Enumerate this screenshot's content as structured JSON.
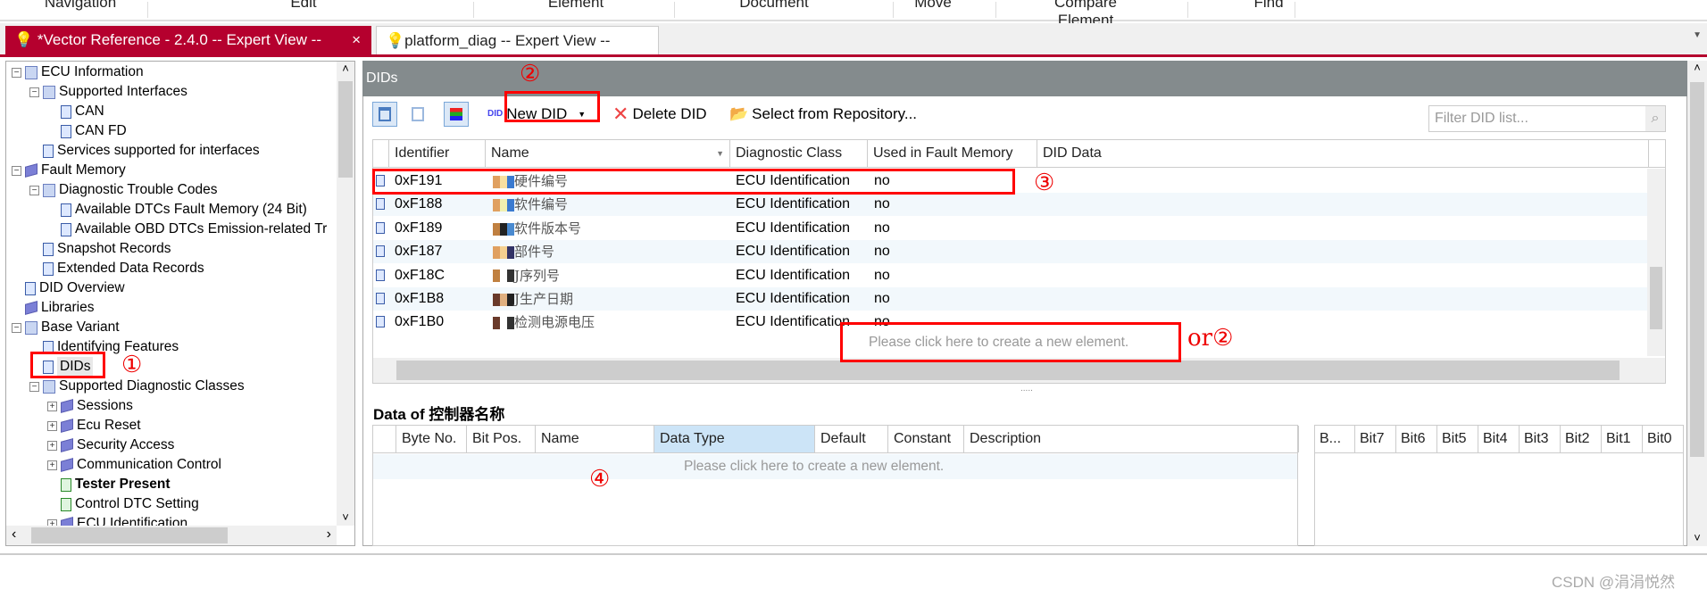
{
  "menu": [
    "Navigation",
    "Edit",
    "Element",
    "Document",
    "Move",
    "Compare Element",
    "Find"
  ],
  "tabs": [
    {
      "label": "*Vector Reference - 2.4.0 -- Expert View --",
      "close": "×",
      "active": true
    },
    {
      "label": "platform_diag -- Expert View --",
      "active": false
    }
  ],
  "tree": [
    {
      "label": "ECU Information",
      "level": 0,
      "exp": "−",
      "icon": "book-open"
    },
    {
      "label": "Supported Interfaces",
      "level": 1,
      "exp": "−",
      "icon": "book-open"
    },
    {
      "label": "CAN",
      "level": 2,
      "icon": "doc"
    },
    {
      "label": "CAN FD",
      "level": 2,
      "icon": "doc"
    },
    {
      "label": "Services supported for interfaces",
      "level": 1,
      "icon": "doc"
    },
    {
      "label": "Fault Memory",
      "level": 0,
      "exp": "−",
      "icon": "book"
    },
    {
      "label": "Diagnostic Trouble Codes",
      "level": 1,
      "exp": "−",
      "icon": "book-open"
    },
    {
      "label": "Available DTCs Fault Memory (24 Bit)",
      "level": 2,
      "icon": "doc"
    },
    {
      "label": "Available OBD DTCs Emission-related Tr",
      "level": 2,
      "icon": "doc"
    },
    {
      "label": "Snapshot Records",
      "level": 1,
      "icon": "doc"
    },
    {
      "label": "Extended Data Records",
      "level": 1,
      "icon": "doc"
    },
    {
      "label": "DID Overview",
      "level": 0,
      "icon": "doc"
    },
    {
      "label": "Libraries",
      "level": 0,
      "icon": "book"
    },
    {
      "label": "Base Variant",
      "level": 0,
      "exp": "−",
      "icon": "book-open"
    },
    {
      "label": "Identifying Features",
      "level": 1,
      "icon": "doc"
    },
    {
      "label": "DIDs",
      "level": 1,
      "icon": "doc",
      "selected": true
    },
    {
      "label": "Supported Diagnostic Classes",
      "level": 1,
      "exp": "−",
      "icon": "book-open"
    },
    {
      "label": "Sessions",
      "level": 2,
      "exp": "+",
      "icon": "book"
    },
    {
      "label": "Ecu Reset",
      "level": 2,
      "exp": "+",
      "icon": "book"
    },
    {
      "label": "Security Access",
      "level": 2,
      "exp": "+",
      "icon": "book"
    },
    {
      "label": "Communication Control",
      "level": 2,
      "exp": "+",
      "icon": "book"
    },
    {
      "label": "Tester Present",
      "level": 2,
      "icon": "green",
      "bold": true
    },
    {
      "label": "Control DTC Setting",
      "level": 2,
      "icon": "green"
    },
    {
      "label": "ECU Identification",
      "level": 2,
      "exp": "+",
      "icon": "book"
    }
  ],
  "dids": {
    "title": "DIDs",
    "toolbar": {
      "new": "New DID",
      "delete": "Delete DID",
      "repo": "Select from Repository...",
      "did_icon_text": "DID"
    },
    "filter_placeholder": "Filter DID list...",
    "columns": [
      "Identifier",
      "Name",
      "Diagnostic Class",
      "Used in Fault Memory",
      "DID Data"
    ],
    "rows": [
      {
        "id": "0xF191",
        "name": "硬件编号",
        "cls": "ECU Identification",
        "fault": "no"
      },
      {
        "id": "0xF188",
        "name": "软件编号",
        "cls": "ECU Identification",
        "fault": "no"
      },
      {
        "id": "0xF189",
        "name": "软件版本号",
        "cls": "ECU Identification",
        "fault": "no"
      },
      {
        "id": "0xF187",
        "name": "部件号",
        "cls": "ECU Identification",
        "fault": "no"
      },
      {
        "id": "0xF18C",
        "name": "J序列号",
        "cls": "ECU Identification",
        "fault": "no"
      },
      {
        "id": "0xF1B8",
        "name": "J生产日期",
        "cls": "ECU Identification",
        "fault": "no"
      },
      {
        "id": "0xF1B0",
        "name": "检测电源电压",
        "cls": "ECU Identification",
        "fault": "no"
      }
    ],
    "hint": "Please click here to create a new element."
  },
  "data_section": {
    "title": "Data of 控制器名称",
    "columns": [
      "Byte No.",
      "Bit Pos.",
      "Name",
      "Data Type",
      "Default",
      "Constant",
      "Description"
    ],
    "hint": "Please click here to create a new element.",
    "bit_columns": [
      "B...",
      "Bit7",
      "Bit6",
      "Bit5",
      "Bit4",
      "Bit3",
      "Bit2",
      "Bit1",
      "Bit0"
    ]
  },
  "annotations": {
    "a1": "①",
    "a2": "②",
    "a3": "③",
    "a4": "④",
    "or2": "or②"
  },
  "watermark": "CSDN @涓涓悦然",
  "colors": {
    "accent": "#b5002e",
    "header": "#848b8d",
    "annotation": "#ff0000"
  }
}
